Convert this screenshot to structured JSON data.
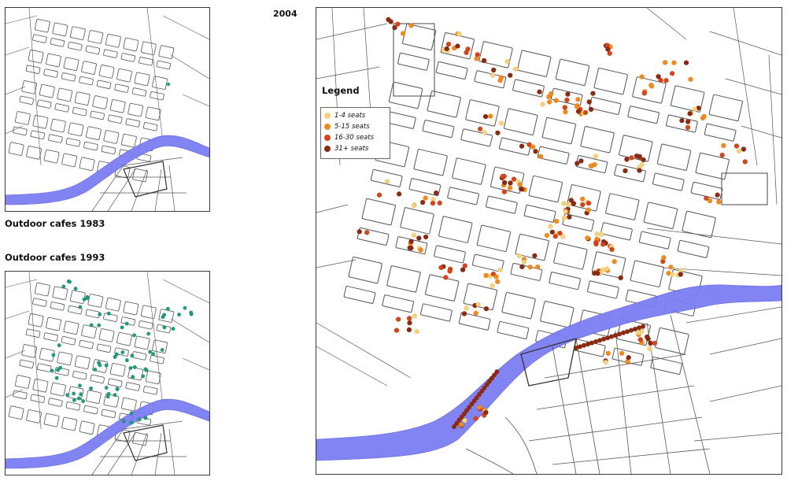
{
  "captions": {
    "map_1983": "Outdoor cafes 1983",
    "map_1993": "Outdoor cafes 1993",
    "map_2004": "2004"
  },
  "legend": {
    "title": "Legend",
    "items": [
      {
        "label": "1-4 seats",
        "color": "#f6d27a"
      },
      {
        "label": "5-15 seats",
        "color": "#f08a1c"
      },
      {
        "label": "16-30 seats",
        "color": "#d4451c"
      },
      {
        "label": "31+ seats",
        "color": "#8a2a12"
      }
    ]
  },
  "colors": {
    "river": "#7b7ef2",
    "street_lines": "#555555",
    "cafe_1983_1993": "#1aa27a",
    "frame": "#3a3a3a"
  }
}
